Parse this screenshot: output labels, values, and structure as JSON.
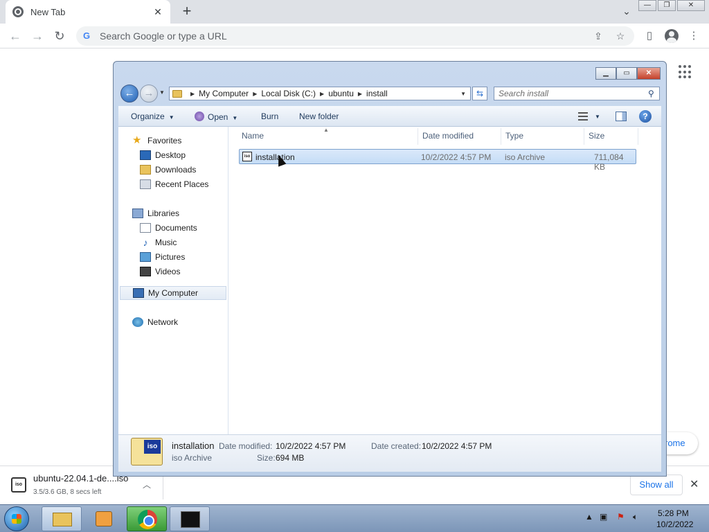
{
  "browser": {
    "tab_title": "New Tab",
    "tab_close": "✕",
    "new_tab": "+",
    "omnibox_placeholder": "Search Google or type a URL",
    "customize_text": "rome"
  },
  "explorer": {
    "breadcrumbs": [
      "My Computer",
      "Local Disk (C:)",
      "ubuntu",
      "install"
    ],
    "search_placeholder": "Search install",
    "commands": {
      "organize": "Organize",
      "open": "Open",
      "burn": "Burn",
      "new_folder": "New folder"
    },
    "nav": {
      "favorites": "Favorites",
      "desktop": "Desktop",
      "downloads": "Downloads",
      "recent_places": "Recent Places",
      "libraries": "Libraries",
      "documents": "Documents",
      "music": "Music",
      "pictures": "Pictures",
      "videos": "Videos",
      "my_computer": "My Computer",
      "network": "Network"
    },
    "columns": {
      "name": "Name",
      "date_modified": "Date modified",
      "type": "Type",
      "size": "Size"
    },
    "files": [
      {
        "name": "installation",
        "date_modified": "10/2/2022 4:57 PM",
        "type": "iso Archive",
        "size": "711,084 KB"
      }
    ],
    "details": {
      "name": "installation",
      "type": "iso Archive",
      "date_modified_label": "Date modified:",
      "date_modified": "10/2/2022 4:57 PM",
      "date_created_label": "Date created:",
      "date_created": "10/2/2022 4:57 PM",
      "size_label": "Size:",
      "size": "694 MB",
      "icon_text": "iso"
    }
  },
  "download_shelf": {
    "filename": "ubuntu-22.04.1-de....iso",
    "status": "3.5/3.6 GB, 8 secs left",
    "show_all": "Show all",
    "icon_text": "iso"
  },
  "taskbar": {
    "time": "5:28 PM",
    "date": "10/2/2022"
  }
}
